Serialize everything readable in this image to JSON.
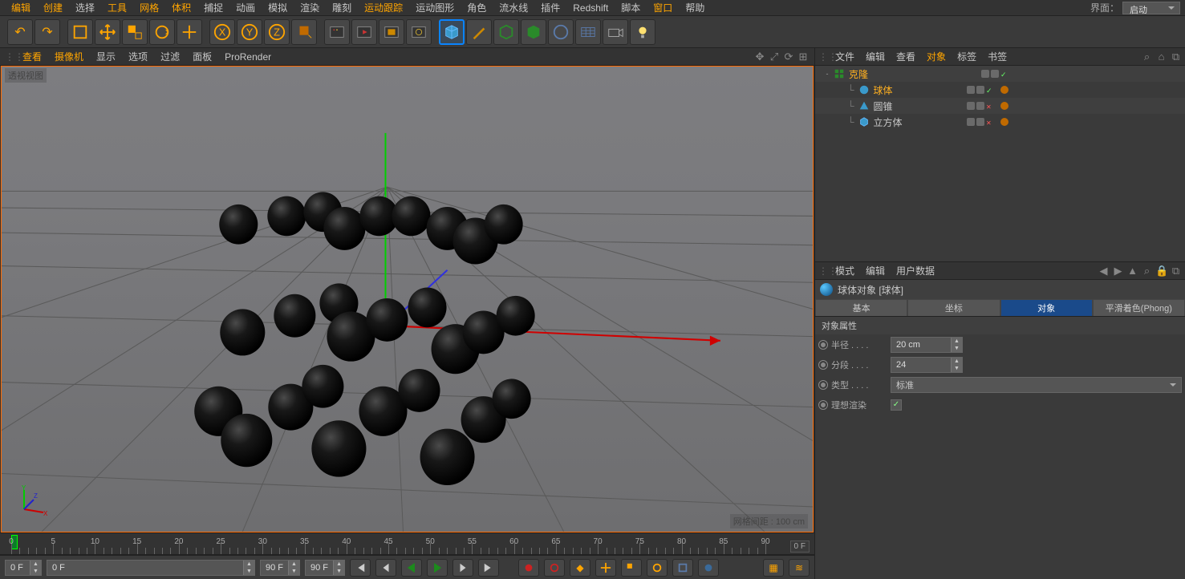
{
  "menu": {
    "items": [
      "编辑",
      "创建",
      "选择",
      "工具",
      "网格",
      "体积",
      "捕捉",
      "动画",
      "模拟",
      "渲染",
      "雕刻",
      "运动跟踪",
      "运动图形",
      "角色",
      "流水线",
      "插件",
      "Redshift",
      "脚本",
      "窗口",
      "帮助"
    ],
    "highlighted": [
      1,
      3,
      4,
      5,
      11,
      18
    ],
    "layout_label": "界面：",
    "layout_value": "启动"
  },
  "vp_menu": {
    "items": [
      "查看",
      "摄像机",
      "显示",
      "选项",
      "过滤",
      "面板",
      "ProRender"
    ],
    "highlighted": [
      0,
      1
    ]
  },
  "viewport": {
    "title": "透视视图",
    "grid_info": "网格间距 : 100 cm"
  },
  "ruler": {
    "start": 0,
    "end": 90,
    "step": 5,
    "cur_frame_label": "0 F"
  },
  "transport": {
    "frame_start": "0 F",
    "range_start": "0 F",
    "range_end": "90 F",
    "frame_end": "90 F"
  },
  "obj_panel_menu": {
    "items": [
      "文件",
      "编辑",
      "查看",
      "对象",
      "标签",
      "书签"
    ],
    "highlighted": [
      3
    ]
  },
  "tree": [
    {
      "indent": 0,
      "toggle": "-",
      "icon": "cloner",
      "label": "克隆",
      "sel": true,
      "vis": [
        "grey",
        "grey"
      ],
      "flag": "check",
      "tag": false
    },
    {
      "indent": 1,
      "toggle": "",
      "icon": "sphere",
      "label": "球体",
      "sel": true,
      "vis": [
        "grey",
        "grey"
      ],
      "flag": "check",
      "tag": true
    },
    {
      "indent": 1,
      "toggle": "",
      "icon": "cone",
      "label": "圆锥",
      "sel": false,
      "vis": [
        "grey",
        "grey"
      ],
      "flag": "cross",
      "tag": true
    },
    {
      "indent": 1,
      "toggle": "",
      "icon": "cube",
      "label": "立方体",
      "sel": false,
      "vis": [
        "grey",
        "grey"
      ],
      "flag": "cross",
      "tag": true
    }
  ],
  "attr_panel_menu": {
    "items": [
      "模式",
      "编辑",
      "用户数据"
    ],
    "highlighted": []
  },
  "attr_head": "球体对象 [球体]",
  "attr_tabs": [
    "基本",
    "坐标",
    "对象",
    "平滑着色(Phong)"
  ],
  "attr_tab_active": 2,
  "attr_section": "对象属性",
  "attr_rows": [
    {
      "key": "radius",
      "label": "半径 . . . .",
      "value": "20 cm",
      "type": "num"
    },
    {
      "key": "segments",
      "label": "分段 . . . .",
      "value": "24",
      "type": "num"
    },
    {
      "key": "type",
      "label": "类型 . . . .",
      "value": "标准",
      "type": "select"
    },
    {
      "key": "ideal",
      "label": "理想渲染",
      "value": "✓",
      "type": "check"
    }
  ]
}
